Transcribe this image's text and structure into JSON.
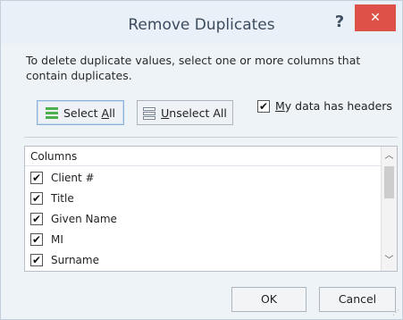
{
  "dialog": {
    "title": "Remove Duplicates",
    "help_symbol": "?",
    "close_symbol": "✕",
    "instructions": "To delete duplicate values, select one or more columns that contain duplicates."
  },
  "buttons": {
    "select_all_pre": "Select ",
    "select_all_ul": "A",
    "select_all_post": "ll",
    "unselect_all_ul": "U",
    "unselect_all_post": "nselect All",
    "ok": "OK",
    "cancel": "Cancel"
  },
  "headers_option": {
    "label_ul": "M",
    "label_rest": "y data has headers",
    "checked": true,
    "check_mark": "✔"
  },
  "columns_list": {
    "header": "Columns",
    "items": [
      {
        "label": "Client #",
        "checked": true
      },
      {
        "label": "Title",
        "checked": true
      },
      {
        "label": "Given Name",
        "checked": true
      },
      {
        "label": "MI",
        "checked": true
      },
      {
        "label": "Surname",
        "checked": true
      }
    ],
    "check_mark": "✔"
  },
  "scrollbar": {
    "up_arrow": "︿",
    "down_arrow": "﹀"
  },
  "icons": {
    "select_all_icon": "select-all-icon",
    "unselect_all_icon": "unselect-all-icon"
  },
  "colors": {
    "close_button": "#de5148",
    "select_icon_green": "#4caf50",
    "unselect_icon_gray": "#7a8593"
  }
}
